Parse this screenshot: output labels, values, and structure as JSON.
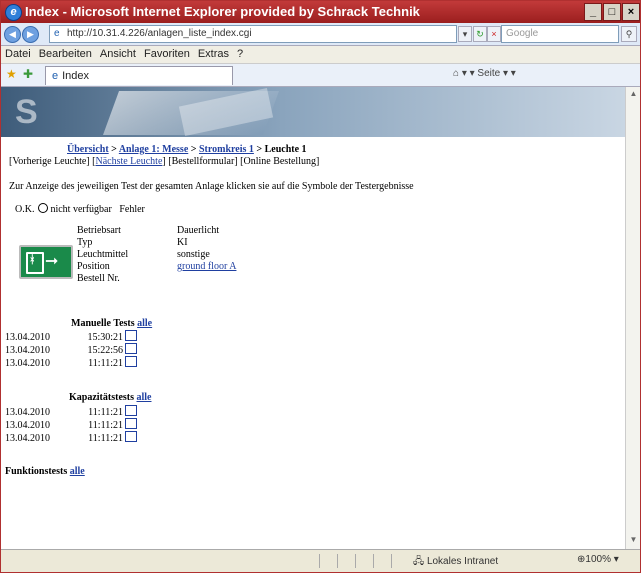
{
  "window": {
    "title": "Index - Microsoft Internet Explorer provided by Schrack Technik",
    "controls": [
      "_",
      "□",
      "×"
    ]
  },
  "address_bar": {
    "url": "http://10.31.4.226/anlagen_liste_index.cgi",
    "search_placeholder": "Google"
  },
  "menu": [
    "Datei",
    "Bearbeiten",
    "Ansicht",
    "Favoriten",
    "Extras",
    "?"
  ],
  "tab": {
    "label": "Index"
  },
  "toolbar_tools": "▾ ▾ Seite ▾ ▾",
  "page": {
    "breadcrumb": {
      "overview": "Übersicht",
      "sep1": " > ",
      "anlage": "Anlage 1: Messe",
      "sep2": " > ",
      "stromkreis": "Stromkreis 1",
      "sep3": " > ",
      "current": "Leuchte 1"
    },
    "nav": {
      "prev": "[Vorherige Leuchte]",
      "next_open": " [",
      "next": "Nächste Leuchte",
      "next_close": "]",
      "order_form": " [Bestellformular]",
      "online_order": " [Online Bestellung]"
    },
    "info_text": "Zur Anzeige des jeweiligen Test der gesamten Anlage klicken sie auf die Symbole der Testergebnisse",
    "legend": {
      "ok": "O.K.",
      "na": "nicht verfügbar",
      "fail": "Fehler"
    },
    "properties": [
      {
        "label": "Betriebsart",
        "value": "Dauerlicht"
      },
      {
        "label": "Typ",
        "value": "KI"
      },
      {
        "label": "Leuchtmittel",
        "value": "sonstige"
      },
      {
        "label": "Position",
        "value": "ground floor A"
      },
      {
        "label": "Bestell Nr.",
        "value": ""
      }
    ],
    "sections": {
      "manual": {
        "title": "Manuelle Tests",
        "all": "alle",
        "rows": [
          {
            "date": "13.04.2010",
            "time": "15:30:21"
          },
          {
            "date": "13.04.2010",
            "time": "15:22:56"
          },
          {
            "date": "13.04.2010",
            "time": "11:11:21"
          }
        ]
      },
      "capacity": {
        "title": "Kapazitätstests",
        "all": "alle",
        "rows": [
          {
            "date": "13.04.2010",
            "time": "11:11:21"
          },
          {
            "date": "13.04.2010",
            "time": "11:11:21"
          },
          {
            "date": "13.04.2010",
            "time": "11:11:21"
          }
        ]
      },
      "function": {
        "title": "Funktionstests",
        "all": "alle"
      }
    }
  },
  "statusbar": {
    "zone": "Lokales Intranet",
    "zoom": "100%"
  },
  "colors": {
    "titlebar": "#b02a2a",
    "link": "#1f3fa0",
    "sign": "#1a8a4a"
  }
}
